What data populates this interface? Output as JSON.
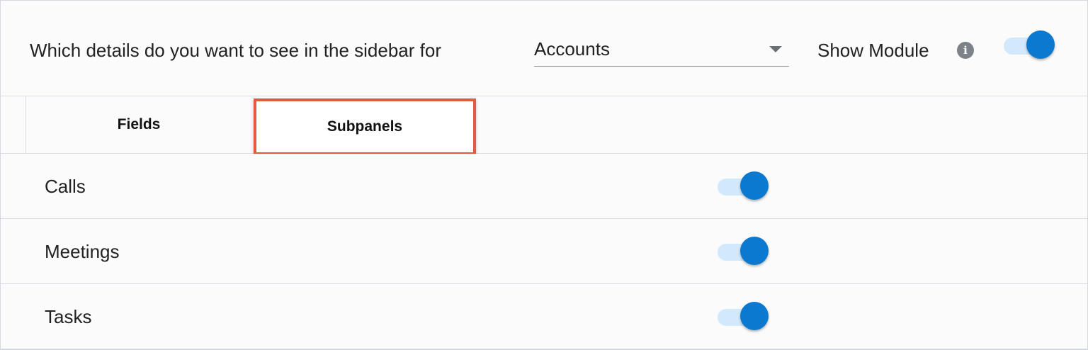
{
  "header": {
    "question": "Which details do you want to see in the sidebar for",
    "module_select": {
      "value": "Accounts"
    },
    "show_module_label": "Show Module",
    "info_glyph": "i",
    "show_module_enabled": true
  },
  "tabs": [
    {
      "label": "Fields",
      "active": false
    },
    {
      "label": "Subpanels",
      "active": true
    }
  ],
  "rows": [
    {
      "label": "Calls",
      "enabled": true
    },
    {
      "label": "Meetings",
      "enabled": true
    },
    {
      "label": "Tasks",
      "enabled": true
    }
  ],
  "colors": {
    "accent": "#0b79d0",
    "toggle_track": "#d2e9fb",
    "highlight_border": "#e25a44"
  },
  "icons": {
    "select_arrow": "chevron-down-icon",
    "info": "info-icon"
  }
}
